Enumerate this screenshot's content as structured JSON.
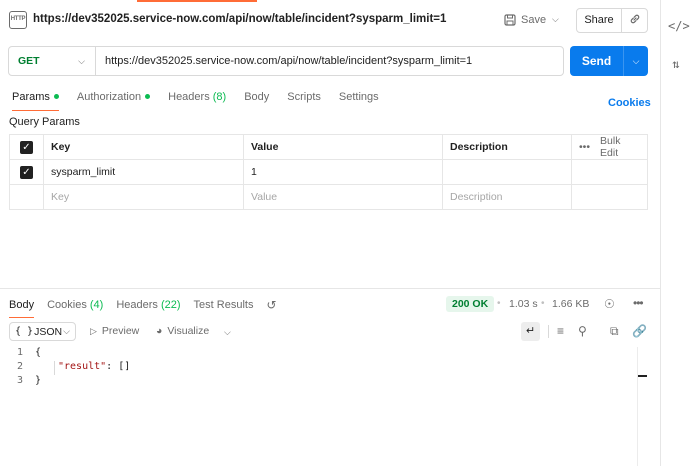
{
  "title": {
    "badge": "HTTP",
    "url": "https://dev352025.service-now.com/api/now/table/incident?sysparm_limit=1",
    "save_label": "Save",
    "share_label": "Share"
  },
  "request": {
    "method": "GET",
    "url": "https://dev352025.service-now.com/api/now/table/incident?sysparm_limit=1",
    "send_label": "Send"
  },
  "request_tabs": [
    {
      "label": "Params",
      "active": true,
      "dot": true
    },
    {
      "label": "Authorization",
      "active": false,
      "dot": true
    },
    {
      "label": "Headers",
      "count": "(8)",
      "active": false
    },
    {
      "label": "Body",
      "active": false
    },
    {
      "label": "Scripts",
      "active": false
    },
    {
      "label": "Settings",
      "active": false
    }
  ],
  "cookies_label": "Cookies",
  "query_params": {
    "title": "Query Params",
    "columns": {
      "key": "Key",
      "value": "Value",
      "description": "Description",
      "bulk_edit": "Bulk Edit"
    },
    "rows": [
      {
        "checked": true,
        "key": "sysparm_limit",
        "value": "1",
        "description": ""
      }
    ],
    "placeholders": {
      "key": "Key",
      "value": "Value",
      "description": "Description"
    }
  },
  "response_tabs": [
    {
      "label": "Body",
      "active": true
    },
    {
      "label": "Cookies",
      "count": "(4)"
    },
    {
      "label": "Headers",
      "count": "(22)"
    },
    {
      "label": "Test Results"
    }
  ],
  "response_meta": {
    "status": "200 OK",
    "time": "1.03 s",
    "size": "1.66 KB"
  },
  "response_toolbar": {
    "format": "JSON",
    "preview": "Preview",
    "visualize": "Visualize"
  },
  "response_body": {
    "lines": [
      {
        "n": "1",
        "text": "{"
      },
      {
        "n": "2",
        "key": "\"result\"",
        "rest": ": []"
      },
      {
        "n": "3",
        "text": "}"
      }
    ]
  },
  "colors": {
    "accent": "#ff6c37",
    "send": "#097bed",
    "method_get": "#007f31",
    "status_ok": "#007f31",
    "enabled_dot": "#0cbb52"
  }
}
